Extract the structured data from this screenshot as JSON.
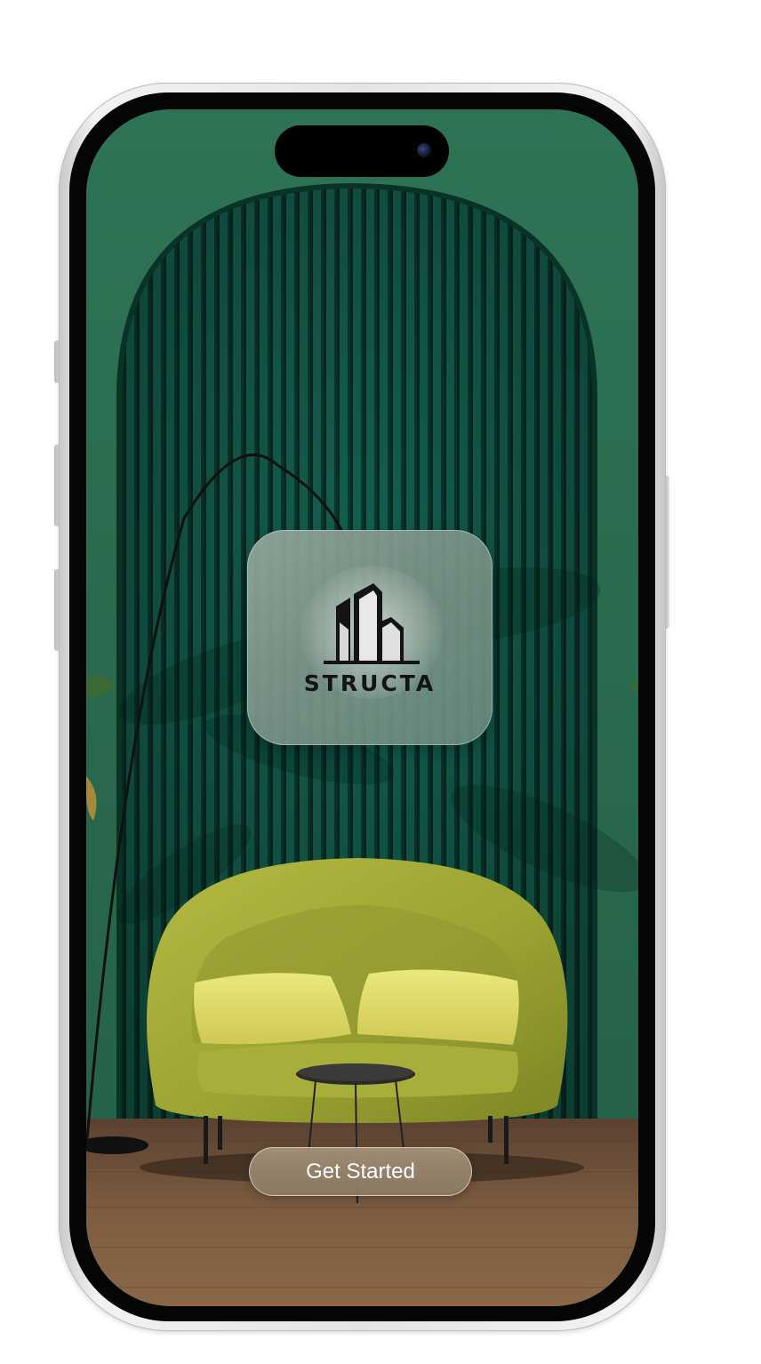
{
  "app": {
    "brand_name": "STRUCTA"
  },
  "welcome": {
    "cta_label": "Get Started"
  },
  "icons": {
    "logo": "building-logo-icon",
    "camera": "front-camera-icon"
  },
  "colors": {
    "wall_green": "#2a6a4f",
    "panel_green": "#0f4a3a",
    "sofa_olive": "#a9b03a",
    "pillow_yellow": "#e3df6a",
    "floor_wood": "#7b5c41",
    "button_tan": "#a08c72",
    "logo_ink": "#141414"
  }
}
